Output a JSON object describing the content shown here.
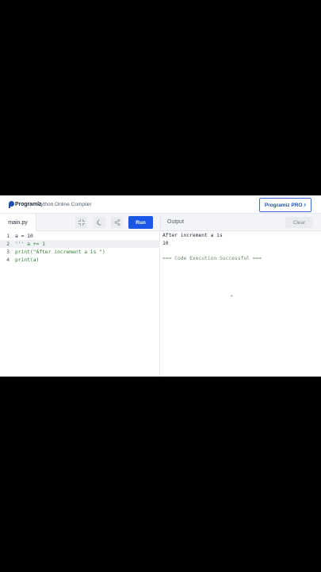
{
  "header": {
    "logo_text": "Programiz",
    "app_title": "Python Online Compiler",
    "pro_label": "Programiz PRO"
  },
  "toolbar": {
    "file_tab": "main.py",
    "run_label": "Run",
    "output_label": "Output",
    "clear_label": "Clear"
  },
  "editor": {
    "lines": [
      {
        "num": "1",
        "text": "a = 10"
      },
      {
        "num": "2",
        "text": "''' a += 1"
      },
      {
        "num": "3",
        "text": "print(\"After increment a is \")"
      },
      {
        "num": "4",
        "text": "print(a)"
      }
    ]
  },
  "output": {
    "lines": [
      "After increment a is",
      "10"
    ],
    "status": "=== Code Execution Successful ==="
  }
}
